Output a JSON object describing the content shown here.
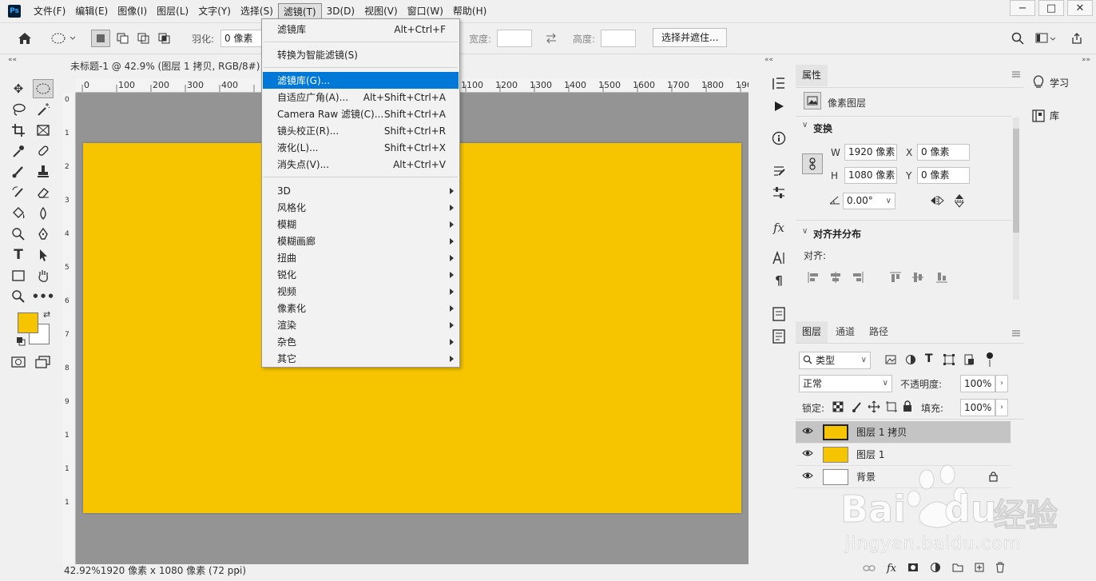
{
  "menubar": {
    "logo": "Ps",
    "items": [
      "文件(F)",
      "编辑(E)",
      "图像(I)",
      "图层(L)",
      "文字(Y)",
      "选择(S)",
      "滤镜(T)",
      "3D(D)",
      "视图(V)",
      "窗口(W)",
      "帮助(H)"
    ],
    "active_index": 6
  },
  "options": {
    "feather_label": "羽化:",
    "feather_value": "0 像素",
    "width_label": "宽度:",
    "height_label": "高度:",
    "select_mask_button": "选择并遮住..."
  },
  "document": {
    "tab_title": "未标题-1 @ 42.9% (图层 1 拷贝, RGB/8#)",
    "tab_close": "×",
    "status": "42.92%",
    "status_size": "1920 像素 x 1080 像素 (72 ppi)",
    "ruler_top": [
      "0",
      "100",
      "200",
      "300",
      "400",
      "1100",
      "1200",
      "1300",
      "1400",
      "1500",
      "1600",
      "1700",
      "1800",
      "190"
    ],
    "ruler_left": [
      "0",
      "1",
      "2",
      "3",
      "4",
      "5",
      "6",
      "7",
      "8",
      "9",
      "1",
      "1",
      "1"
    ],
    "canvas_color": "#f7c500"
  },
  "filter_menu": {
    "items": [
      {
        "label": "滤镜库",
        "shortcut": "Alt+Ctrl+F"
      },
      {
        "label": "转换为智能滤镜(S)",
        "shortcut": ""
      },
      {
        "label": "滤镜库(G)...",
        "shortcut": ""
      },
      {
        "label": "自适应广角(A)...",
        "shortcut": "Alt+Shift+Ctrl+A"
      },
      {
        "label": "Camera Raw 滤镜(C)...",
        "shortcut": "Shift+Ctrl+A"
      },
      {
        "label": "镜头校正(R)...",
        "shortcut": "Shift+Ctrl+R"
      },
      {
        "label": "液化(L)...",
        "shortcut": "Shift+Ctrl+X"
      },
      {
        "label": "消失点(V)...",
        "shortcut": "Alt+Ctrl+V"
      },
      {
        "label": "3D",
        "shortcut": ""
      },
      {
        "label": "风格化",
        "shortcut": ""
      },
      {
        "label": "模糊",
        "shortcut": ""
      },
      {
        "label": "模糊画廊",
        "shortcut": ""
      },
      {
        "label": "扭曲",
        "shortcut": ""
      },
      {
        "label": "锐化",
        "shortcut": ""
      },
      {
        "label": "视频",
        "shortcut": ""
      },
      {
        "label": "像素化",
        "shortcut": ""
      },
      {
        "label": "渲染",
        "shortcut": ""
      },
      {
        "label": "杂色",
        "shortcut": ""
      },
      {
        "label": "其它",
        "shortcut": ""
      }
    ]
  },
  "properties": {
    "tab": "属性",
    "type_label": "像素图层",
    "transform_title": "变换",
    "w_label": "W",
    "w_value": "1920 像素",
    "h_label": "H",
    "h_value": "1080 像素",
    "x_label": "X",
    "x_value": "0 像素",
    "y_label": "Y",
    "y_value": "0 像素",
    "angle_value": "0.00°",
    "align_title": "对齐并分布",
    "align_label": "对齐:"
  },
  "layers": {
    "tabs": [
      "图层",
      "通道",
      "路径"
    ],
    "filter_kind": "类型",
    "blend_mode": "正常",
    "opacity_label": "不透明度:",
    "opacity_value": "100%",
    "lock_label": "锁定:",
    "fill_label": "填充:",
    "fill_value": "100%",
    "rows": [
      {
        "name": "图层 1 拷贝",
        "thumb": "#f7c500"
      },
      {
        "name": "图层 1",
        "thumb": "#f7c500"
      },
      {
        "name": "背景",
        "thumb": "#ffffff"
      }
    ]
  },
  "learn": {
    "learn_label": "学习",
    "library_label": "库"
  },
  "colors": {
    "foreground": "#f7c500",
    "background": "#ffffff",
    "highlight": "#0078d7"
  },
  "watermark": {
    "brand": "Bai",
    "brand2": "du",
    "cn": "经验",
    "url": "jingyan.baidu.com"
  }
}
